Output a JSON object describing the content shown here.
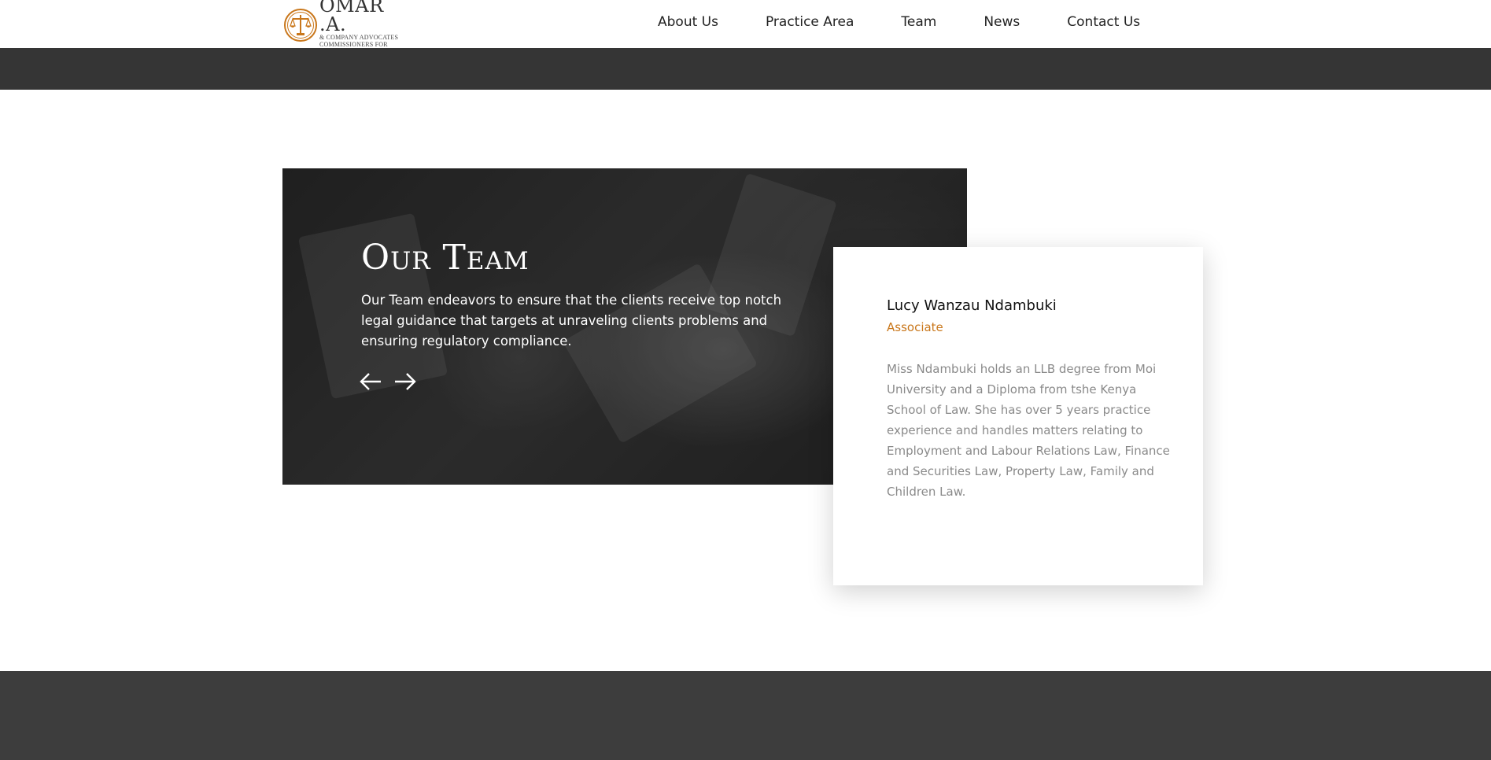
{
  "brand": {
    "name": "OMAR .A.",
    "subtitle_1": "& COMPANY ADVOCATES",
    "subtitle_2": "COMMISSIONERS FOR OATHS",
    "logo_icon": "scales-of-justice-icon",
    "accent_color": "#c9771b"
  },
  "nav": {
    "items": [
      {
        "label": "About Us"
      },
      {
        "label": "Practice Area"
      },
      {
        "label": "Team"
      },
      {
        "label": "News"
      },
      {
        "label": "Contact Us"
      }
    ]
  },
  "hero": {
    "title": "Our Team",
    "description": "Our Team endeavors to ensure that the clients receive top notch legal guidance that targets at unraveling clients problems and ensuring regulatory compliance.",
    "prev_icon": "arrow-left-icon",
    "next_icon": "arrow-right-icon"
  },
  "member": {
    "name": "Lucy Wanzau Ndambuki",
    "role": "Associate",
    "bio": "Miss Ndambuki holds an LLB degree from Moi University and a Diploma from tshe Kenya School of Law. She has over 5 years practice experience and handles matters relating to Employment and Labour Relations Law, Finance and Securities Law, Property Law, Family and Children Law."
  }
}
